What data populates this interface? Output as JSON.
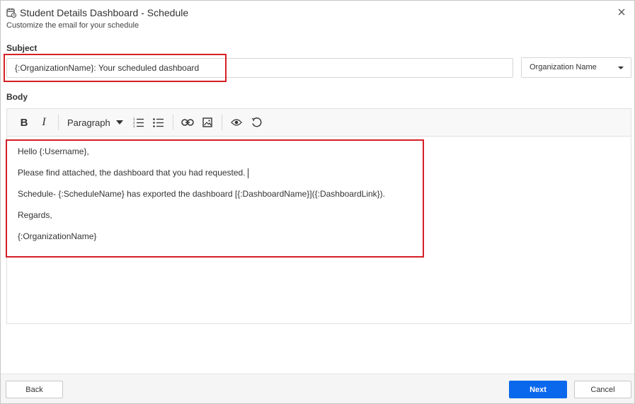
{
  "dialog": {
    "title": "Student Details Dashboard - Schedule",
    "subtitle": "Customize the email for your schedule"
  },
  "subject": {
    "label": "Subject",
    "value": "{:OrganizationName}: Your scheduled dashboard",
    "placeholder_dropdown": "Organization Name"
  },
  "body": {
    "label": "Body",
    "toolbar": {
      "paragraph_label": "Paragraph"
    },
    "lines": [
      "Hello {:Username},",
      "Please find attached, the dashboard that you had requested.",
      "Schedule- {:ScheduleName} has exported the dashboard [{:DashboardName}]({:DashboardLink}).",
      "Regards,",
      "{:OrganizationName}"
    ]
  },
  "footer": {
    "back_label": "Back",
    "next_label": "Next",
    "cancel_label": "Cancel"
  },
  "colors": {
    "primary": "#0a68ed",
    "highlight": "#d61f26"
  },
  "icons": [
    "calendar-icon",
    "close-icon",
    "bold-icon",
    "italic-icon",
    "ordered-list-icon",
    "unordered-list-icon",
    "link-icon",
    "image-icon",
    "preview-icon",
    "reset-icon"
  ]
}
